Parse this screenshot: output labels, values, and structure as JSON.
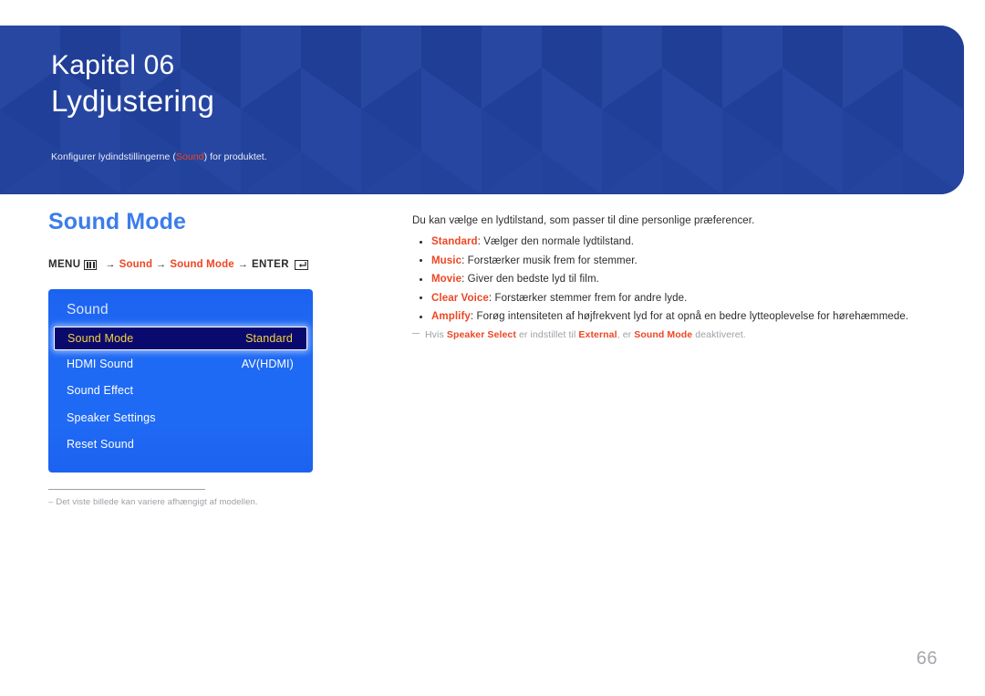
{
  "banner": {
    "chapter_label": "Kapitel 06",
    "chapter_title": "Lydjustering",
    "desc_prefix": "Konfigurer lydindstillingerne (",
    "desc_keyword": "Sound",
    "desc_suffix": ") for produktet.",
    "background_color": "#23429c"
  },
  "section": {
    "title": "Sound Mode",
    "title_color": "#3b7dec"
  },
  "menu_path": {
    "menu_label": "MENU",
    "menu_icon": "menu-bars-icon",
    "arrow": "→",
    "step1": "Sound",
    "step2": "Sound Mode",
    "enter_label": "ENTER",
    "enter_icon": "enter-key-icon"
  },
  "osd": {
    "title": "Sound",
    "rows": [
      {
        "label": "Sound Mode",
        "value": "Standard",
        "selected": true
      },
      {
        "label": "HDMI Sound",
        "value": "AV(HDMI)",
        "selected": false
      },
      {
        "label": "Sound Effect",
        "value": "",
        "selected": false
      },
      {
        "label": "Speaker Settings",
        "value": "",
        "selected": false
      },
      {
        "label": "Reset Sound",
        "value": "",
        "selected": false
      }
    ],
    "background_color": "#1f6af5",
    "selected_background_color": "#0a0a6e",
    "selected_text_color": "#f5d23c"
  },
  "left_footnote": {
    "dash": "–",
    "text": "Det viste billede kan variere afhængigt af modellen."
  },
  "content": {
    "intro": "Du kan vælge en lydtilstand, som passer til dine personlige præferencer.",
    "bullets": [
      {
        "keyword": "Standard",
        "text": ": Vælger den normale lydtilstand."
      },
      {
        "keyword": "Music",
        "text": ": Forstærker musik frem for stemmer."
      },
      {
        "keyword": "Movie",
        "text": ": Giver den bedste lyd til film."
      },
      {
        "keyword": "Clear Voice",
        "text": ": Forstærker stemmer frem for andre lyde."
      },
      {
        "keyword": "Amplify",
        "text": ": Forøg intensiteten af højfrekvent lyd for at opnå en bedre lytteoplevelse for hørehæmmede."
      }
    ],
    "note": {
      "part1": "Hvis ",
      "kw1": "Speaker Select",
      "part2": " er indstillet til ",
      "kw2": "External",
      "part3": ", er ",
      "kw3": "Sound Mode",
      "part4": " deaktiveret."
    }
  },
  "page_number": "66",
  "accent_red": "#ee4623"
}
